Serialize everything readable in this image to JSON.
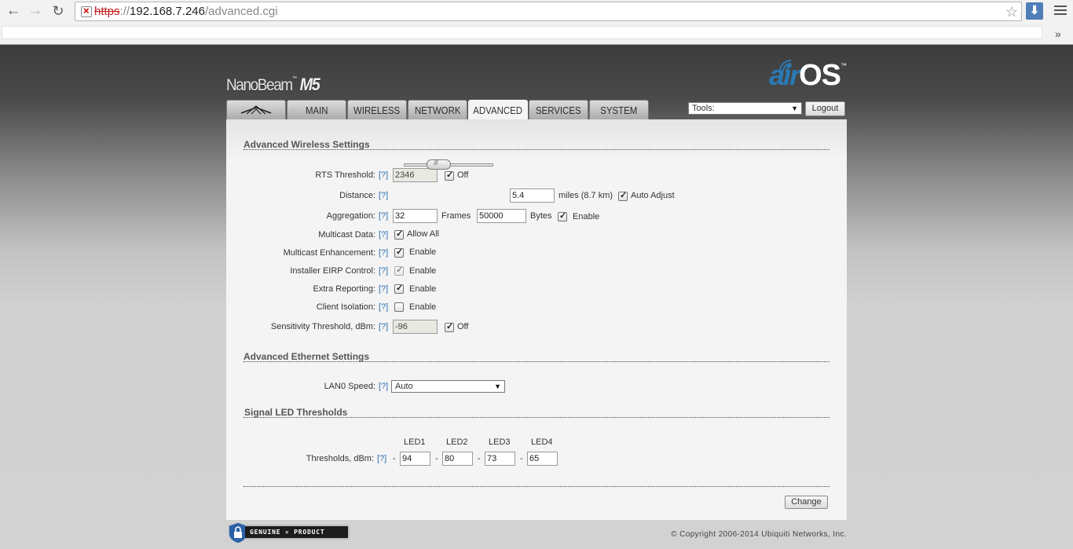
{
  "browser": {
    "url_scheme": "https",
    "url_sep": "://",
    "url_host": "192.168.7.246",
    "url_path": "/advanced.cgi",
    "overflow_glyph": "»"
  },
  "header": {
    "product_name": "NanoBeam",
    "product_tm": "™",
    "product_model": "M5",
    "logo_air": "air",
    "logo_os": "OS",
    "logo_tm": "™"
  },
  "tabs": [
    {
      "label": "",
      "icon": "ubiquiti-logo-icon"
    },
    {
      "label": "MAIN"
    },
    {
      "label": "WIRELESS"
    },
    {
      "label": "NETWORK"
    },
    {
      "label": "ADVANCED",
      "active": true
    },
    {
      "label": "SERVICES"
    },
    {
      "label": "SYSTEM"
    }
  ],
  "toolbar": {
    "tools_value": "Tools:",
    "logout_label": "Logout"
  },
  "wireless": {
    "title": "Advanced Wireless Settings",
    "help": "[?]",
    "rts_label": "RTS Threshold:",
    "rts_value": "2346",
    "rts_off_label": "Off",
    "distance_label": "Distance:",
    "distance_value": "5.4",
    "distance_unit": "miles (8.7 km)",
    "distance_slider_fraction": 0.35,
    "auto_adjust_label": "Auto Adjust",
    "aggregation_label": "Aggregation:",
    "aggregation_frames_value": "32",
    "frames_label": "Frames",
    "aggregation_bytes_value": "50000",
    "bytes_label": "Bytes",
    "enable_label": "Enable",
    "multicast_label": "Multicast Data:",
    "allow_all_label": "Allow All",
    "mc_enh_label": "Multicast Enhancement:",
    "eirp_label": "Installer EIRP Control:",
    "extra_label": "Extra Reporting:",
    "isolation_label": "Client Isolation:",
    "sensitivity_label": "Sensitivity Threshold, dBm:",
    "sensitivity_value": "-96",
    "sensitivity_off_label": "Off"
  },
  "ethernet": {
    "title": "Advanced Ethernet Settings",
    "lan_label": "LAN0 Speed:",
    "lan_value": "Auto"
  },
  "led": {
    "title": "Signal LED Thresholds",
    "headers": [
      "LED1",
      "LED2",
      "LED3",
      "LED4"
    ],
    "thresholds_label": "Thresholds, dBm:",
    "dash": "-",
    "values": [
      "94",
      "80",
      "73",
      "65"
    ]
  },
  "footer": {
    "change_label": "Change",
    "badge_text": "GENUINE  ✕  PRODUCT",
    "copyright": "© Copyright 2006-2014 Ubiquiti Networks, Inc."
  }
}
